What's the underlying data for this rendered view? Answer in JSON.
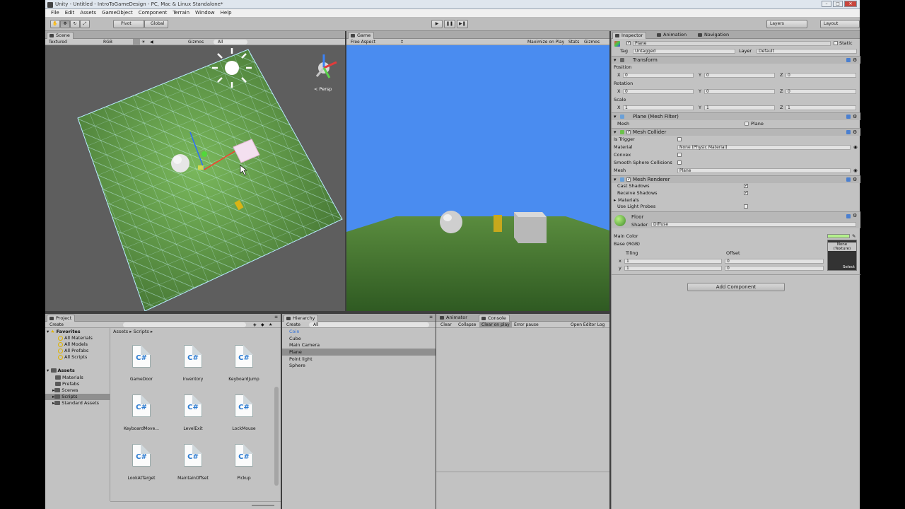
{
  "window": {
    "title": "Unity - Untitled - IntroToGameDesign - PC, Mac & Linux Standalone*"
  },
  "menu": [
    "File",
    "Edit",
    "Assets",
    "GameObject",
    "Component",
    "Terrain",
    "Window",
    "Help"
  ],
  "toolbar": {
    "pivot": "Pivot",
    "global": "Global",
    "layers": "Layers",
    "layout": "Layout"
  },
  "scene": {
    "tab": "Scene",
    "shading": "Textured",
    "render": "RGB",
    "gizmos": "Gizmos",
    "search": "All",
    "persp": "Persp"
  },
  "game": {
    "tab": "Game",
    "aspect": "Free Aspect",
    "maximize": "Maximize on Play",
    "stats": "Stats",
    "gizmos": "Gizmos",
    "sky_color": "#4a8cf0"
  },
  "inspector": {
    "tabs": {
      "inspector": "Inspector",
      "animation": "Animation",
      "navigation": "Navigation"
    },
    "object_name": "Plane",
    "static": "Static",
    "tag_label": "Tag",
    "tag_value": "Untagged",
    "layer_label": "Layer",
    "layer_value": "Default",
    "transform": {
      "title": "Transform",
      "position": "Position",
      "rotation": "Rotation",
      "scale": "Scale",
      "pos": {
        "x": "0",
        "y": "0",
        "z": "0"
      },
      "rot": {
        "x": "0",
        "y": "0",
        "z": "0"
      },
      "scl": {
        "x": "1",
        "y": "1",
        "z": "1"
      }
    },
    "mesh_filter": {
      "title": "Plane (Mesh Filter)",
      "mesh_label": "Mesh",
      "mesh_value": "Plane"
    },
    "mesh_collider": {
      "title": "Mesh Collider",
      "is_trigger": "Is Trigger",
      "material": "Material",
      "material_value": "None (Physic Material)",
      "convex": "Convex",
      "smooth": "Smooth Sphere Collisions",
      "mesh": "Mesh",
      "mesh_value": "Plane"
    },
    "mesh_renderer": {
      "title": "Mesh Renderer",
      "cast": "Cast Shadows",
      "receive": "Receive Shadows",
      "materials": "Materials",
      "probes": "Use Light Probes"
    },
    "material": {
      "name": "Floor",
      "shader_label": "Shader",
      "shader_value": "Diffuse",
      "main_color": "Main Color",
      "base": "Base (RGB)",
      "tiling": "Tiling",
      "offset": "Offset",
      "tx": "1",
      "ty": "1",
      "ox": "0",
      "oy": "0",
      "texture": "None (Texture)",
      "select": "Select",
      "color": "#b4f08c"
    },
    "add_component": "Add Component"
  },
  "project": {
    "tab": "Project",
    "create": "Create",
    "breadcrumb": "Assets ▸ Scripts ▸",
    "favorites": "Favorites",
    "fav_items": [
      "All Materials",
      "All Models",
      "All Prefabs",
      "All Scripts"
    ],
    "assets": "Assets",
    "folders": [
      "Materials",
      "Prefabs",
      "Scenes",
      "Scripts",
      "Standard Assets"
    ],
    "scripts": [
      "GameDoor",
      "Inventory",
      "KeyboardJump",
      "KeyboardMove...",
      "LevelExit",
      "LockMouse",
      "LookAtTarget",
      "MaintainOffset",
      "Pickup"
    ],
    "cs": "C#"
  },
  "hierarchy": {
    "tab": "Hierarchy",
    "create": "Create",
    "search": "All",
    "items": [
      "Coin",
      "Cube",
      "Main Camera",
      "Plane",
      "Point light",
      "Sphere"
    ]
  },
  "console": {
    "tabs": {
      "animator": "Animator",
      "console": "Console"
    },
    "clear": "Clear",
    "collapse": "Collapse",
    "clear_on_play": "Clear on play",
    "error_pause": "Error pause",
    "open_log": "Open Editor Log"
  }
}
